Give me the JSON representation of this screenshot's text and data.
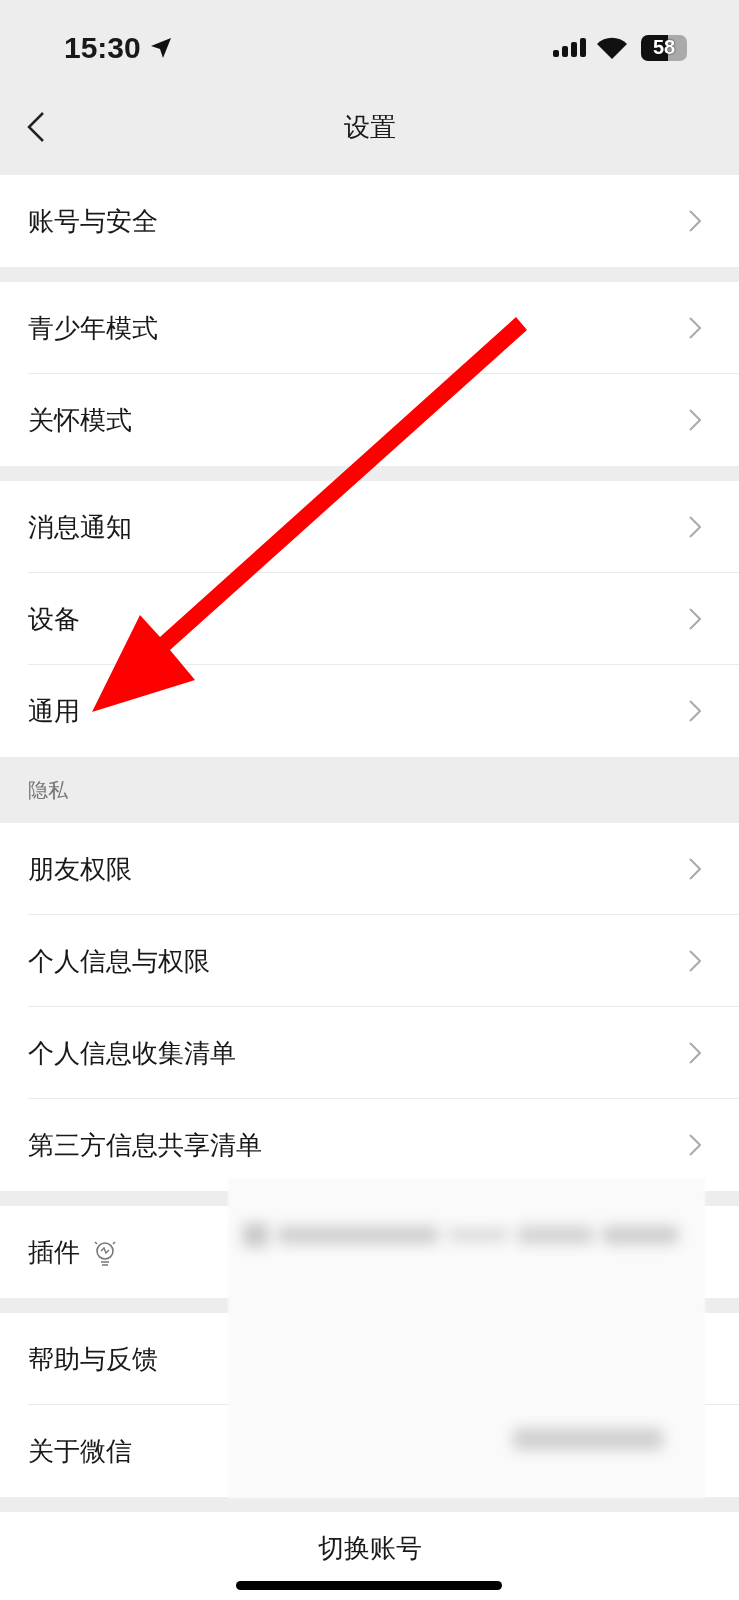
{
  "status_bar": {
    "time": "15:30",
    "battery": "58"
  },
  "nav": {
    "title": "设置"
  },
  "groups": [
    {
      "items": [
        {
          "label": "账号与安全",
          "chevron": true,
          "bulb": false
        }
      ]
    },
    {
      "items": [
        {
          "label": "青少年模式",
          "chevron": true,
          "bulb": false
        },
        {
          "label": "关怀模式",
          "chevron": true,
          "bulb": false
        }
      ]
    },
    {
      "items": [
        {
          "label": "消息通知",
          "chevron": true,
          "bulb": false
        },
        {
          "label": "设备",
          "chevron": true,
          "bulb": false
        },
        {
          "label": "通用",
          "chevron": true,
          "bulb": false
        }
      ]
    },
    {
      "header": "隐私",
      "items": [
        {
          "label": "朋友权限",
          "chevron": true,
          "bulb": false
        },
        {
          "label": "个人信息与权限",
          "chevron": true,
          "bulb": false
        },
        {
          "label": "个人信息收集清单",
          "chevron": true,
          "bulb": false
        },
        {
          "label": "第三方信息共享清单",
          "chevron": true,
          "bulb": false
        }
      ]
    },
    {
      "items": [
        {
          "label": "插件",
          "bulb": true
        }
      ]
    },
    {
      "items": [
        {
          "label": "帮助与反馈",
          "bulb": false
        },
        {
          "label": "关于微信",
          "bulb": false
        }
      ]
    }
  ],
  "switch_account": "切换账号",
  "overlays": [
    {
      "kind": "arrow",
      "color": "#ff0000"
    },
    {
      "kind": "blur"
    }
  ]
}
